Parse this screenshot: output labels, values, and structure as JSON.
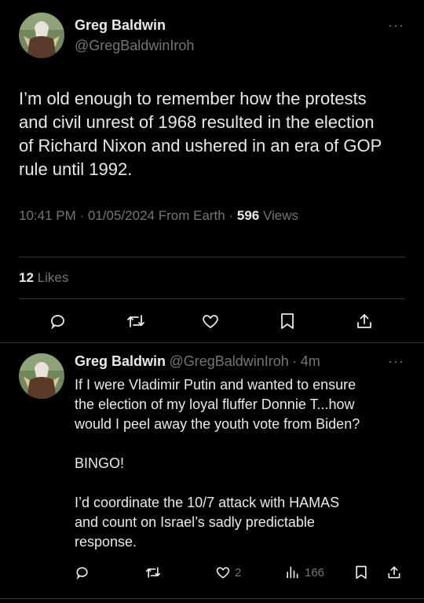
{
  "main_tweet": {
    "author_name": "Greg Baldwin",
    "author_handle": "@GregBaldwinIroh",
    "more_label": "···",
    "text_lines": [
      "I’m old enough to remember how the protests",
      "and civil unrest of 1968 resulted in the election",
      "of Richard Nixon and ushered in an era of GOP",
      "rule until 1992."
    ],
    "time": "10:41 PM",
    "date": "01/05/2024",
    "source": "From Earth",
    "views_count": "596",
    "views_label": "Views",
    "likes_count": "12",
    "likes_label": "Likes"
  },
  "reply_tweet": {
    "author_name": "Greg Baldwin",
    "author_handle": "@GregBaldwinIroh",
    "age": "4m",
    "more_label": "···",
    "text": "If I were Vladimir Putin and wanted to ensure\nthe election of my loyal fluffer Donnie T...how\nwould I peel away the youth vote from Biden?\n\nBINGO!\n\nI’d coordinate the 10/7 attack with HAMAS\nand count on Israel’s sadly predictable\nresponse.",
    "like_count": "2",
    "view_count": "166"
  },
  "icons": {
    "reply": "reply-icon",
    "retweet": "retweet-icon",
    "like": "heart-icon",
    "bookmark": "bookmark-icon",
    "share": "share-icon",
    "views": "views-icon"
  },
  "colors": {
    "background": "#000000",
    "text": "#e7e9ea",
    "muted": "#71767b",
    "divider": "#2f3336"
  }
}
